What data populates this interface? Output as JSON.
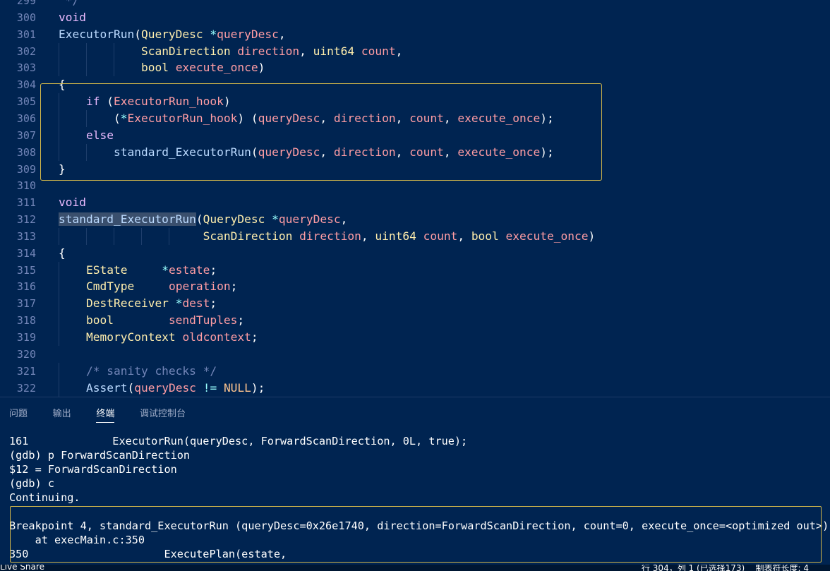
{
  "editor": {
    "lines": [
      {
        "num": "299",
        "text": " */"
      },
      {
        "num": "300",
        "text": "void"
      },
      {
        "num": "301",
        "text": "ExecutorRun(QueryDesc *queryDesc,"
      },
      {
        "num": "302",
        "text": "            ScanDirection direction, uint64 count,"
      },
      {
        "num": "303",
        "text": "            bool execute_once)"
      },
      {
        "num": "304",
        "text": "{"
      },
      {
        "num": "305",
        "text": "    if (ExecutorRun_hook)"
      },
      {
        "num": "306",
        "text": "        (*ExecutorRun_hook) (queryDesc, direction, count, execute_once);"
      },
      {
        "num": "307",
        "text": "    else"
      },
      {
        "num": "308",
        "text": "        standard_ExecutorRun(queryDesc, direction, count, execute_once);"
      },
      {
        "num": "309",
        "text": "}"
      },
      {
        "num": "310",
        "text": ""
      },
      {
        "num": "311",
        "text": "void"
      },
      {
        "num": "312",
        "text": "standard_ExecutorRun(QueryDesc *queryDesc,"
      },
      {
        "num": "313",
        "text": "                     ScanDirection direction, uint64 count, bool execute_once)"
      },
      {
        "num": "314",
        "text": "{"
      },
      {
        "num": "315",
        "text": "    EState     *estate;"
      },
      {
        "num": "316",
        "text": "    CmdType     operation;"
      },
      {
        "num": "317",
        "text": "    DestReceiver *dest;"
      },
      {
        "num": "318",
        "text": "    bool        sendTuples;"
      },
      {
        "num": "319",
        "text": "    MemoryContext oldcontext;"
      },
      {
        "num": "320",
        "text": ""
      },
      {
        "num": "321",
        "text": "    /* sanity checks */"
      },
      {
        "num": "322",
        "text": "    Assert(queryDesc != NULL);"
      }
    ]
  },
  "panel": {
    "tabs": [
      "问题",
      "输出",
      "终端",
      "调试控制台"
    ],
    "active_tab": "终端",
    "terminal_lines": [
      "161             ExecutorRun(queryDesc, ForwardScanDirection, 0L, true);",
      "(gdb) p ForwardScanDirection",
      "$12 = ForwardScanDirection",
      "(gdb) c",
      "Continuing.",
      "",
      "Breakpoint 4, standard_ExecutorRun (queryDesc=0x26e1740, direction=ForwardScanDirection, count=0, execute_once=<optimized out>)",
      "    at execMain.c:350",
      "350                     ExecutePlan(estate,"
    ]
  },
  "statusbar": {
    "left": "Live Share",
    "right": "行 304，列 1 (已选择173)    制表符长度: 4"
  },
  "colors": {
    "background": "#002451",
    "keyword": "#ebbbff",
    "type": "#ffeead",
    "function": "#bbdaff",
    "variable": "#ff9da4",
    "comment": "#7285b7",
    "line_number": "#7285b7",
    "find_border": "#d4b84a"
  }
}
